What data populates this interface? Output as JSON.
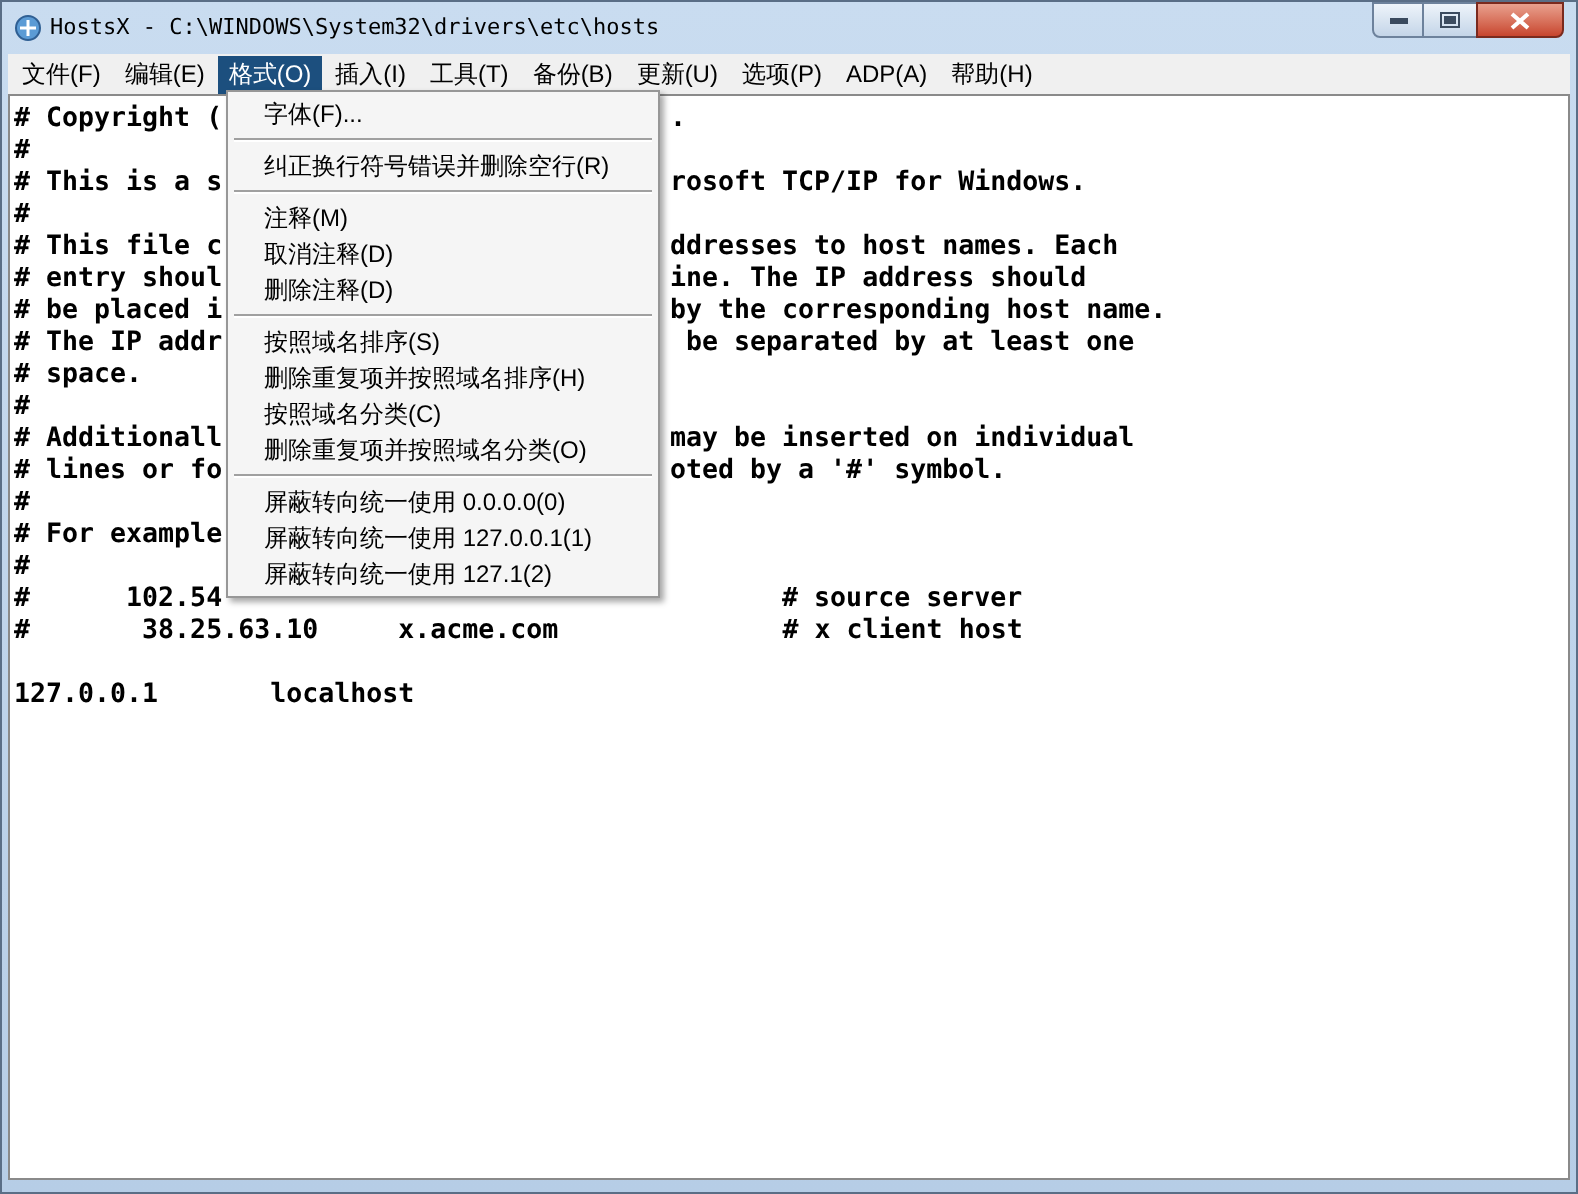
{
  "window": {
    "title": "HostsX - C:\\WINDOWS\\System32\\drivers\\etc\\hosts"
  },
  "menu_bar": [
    {
      "label": "文件(F)",
      "selected": false
    },
    {
      "label": "编辑(E)",
      "selected": false
    },
    {
      "label": "格式(O)",
      "selected": true
    },
    {
      "label": "插入(I)",
      "selected": false
    },
    {
      "label": "工具(T)",
      "selected": false
    },
    {
      "label": "备份(B)",
      "selected": false
    },
    {
      "label": "更新(U)",
      "selected": false
    },
    {
      "label": "选项(P)",
      "selected": false
    },
    {
      "label": "ADP(A)",
      "selected": false
    },
    {
      "label": "帮助(H)",
      "selected": false
    }
  ],
  "format_menu": [
    [
      "字体(F)..."
    ],
    [
      "纠正换行符号错误并删除空行(R)"
    ],
    [
      "注释(M)",
      "取消注释(D)",
      "删除注释(D)"
    ],
    [
      "按照域名排序(S)",
      "删除重复项并按照域名排序(H)",
      "按照域名分类(C)",
      "删除重复项并按照域名分类(O)"
    ],
    [
      "屏蔽转向统一使用 0.0.0.0(0)",
      "屏蔽转向统一使用 127.0.0.1(1)",
      "屏蔽转向统一使用 127.1(2)"
    ]
  ],
  "editor_paragraphs": [
    [
      {
        "text": "# Copyright (",
        "text_right": "."
      },
      {
        "text": "#"
      },
      {
        "text": "# This is a s",
        "text_right": "rosoft TCP/IP for Windows."
      },
      {
        "text": "#"
      },
      {
        "text": "# This file c",
        "text_right": "ddresses to host names. Each"
      },
      {
        "text": "# entry shoul",
        "text_right": "ine. The IP address should"
      },
      {
        "text": "# be placed i",
        "text_right": "by the corresponding host name."
      },
      {
        "text": "# The IP addr",
        "text_right": " be separated by at least one"
      },
      {
        "text": "# space."
      },
      {
        "text": "#"
      },
      {
        "text": "# Additionall",
        "text_right": "may be inserted on individual"
      },
      {
        "text": "# lines or fo",
        "text_right": "oted by a '#' symbol."
      },
      {
        "text": "#"
      },
      {
        "text": "# For example"
      },
      {
        "text": "#"
      },
      {
        "text": "#      102.54",
        "text_right": "       # source server"
      },
      {
        "text": "#       38.25.63.10     x.acme.com              # x client host"
      }
    ],
    [
      {
        "text": "127.0.0.1       localhost"
      }
    ]
  ]
}
